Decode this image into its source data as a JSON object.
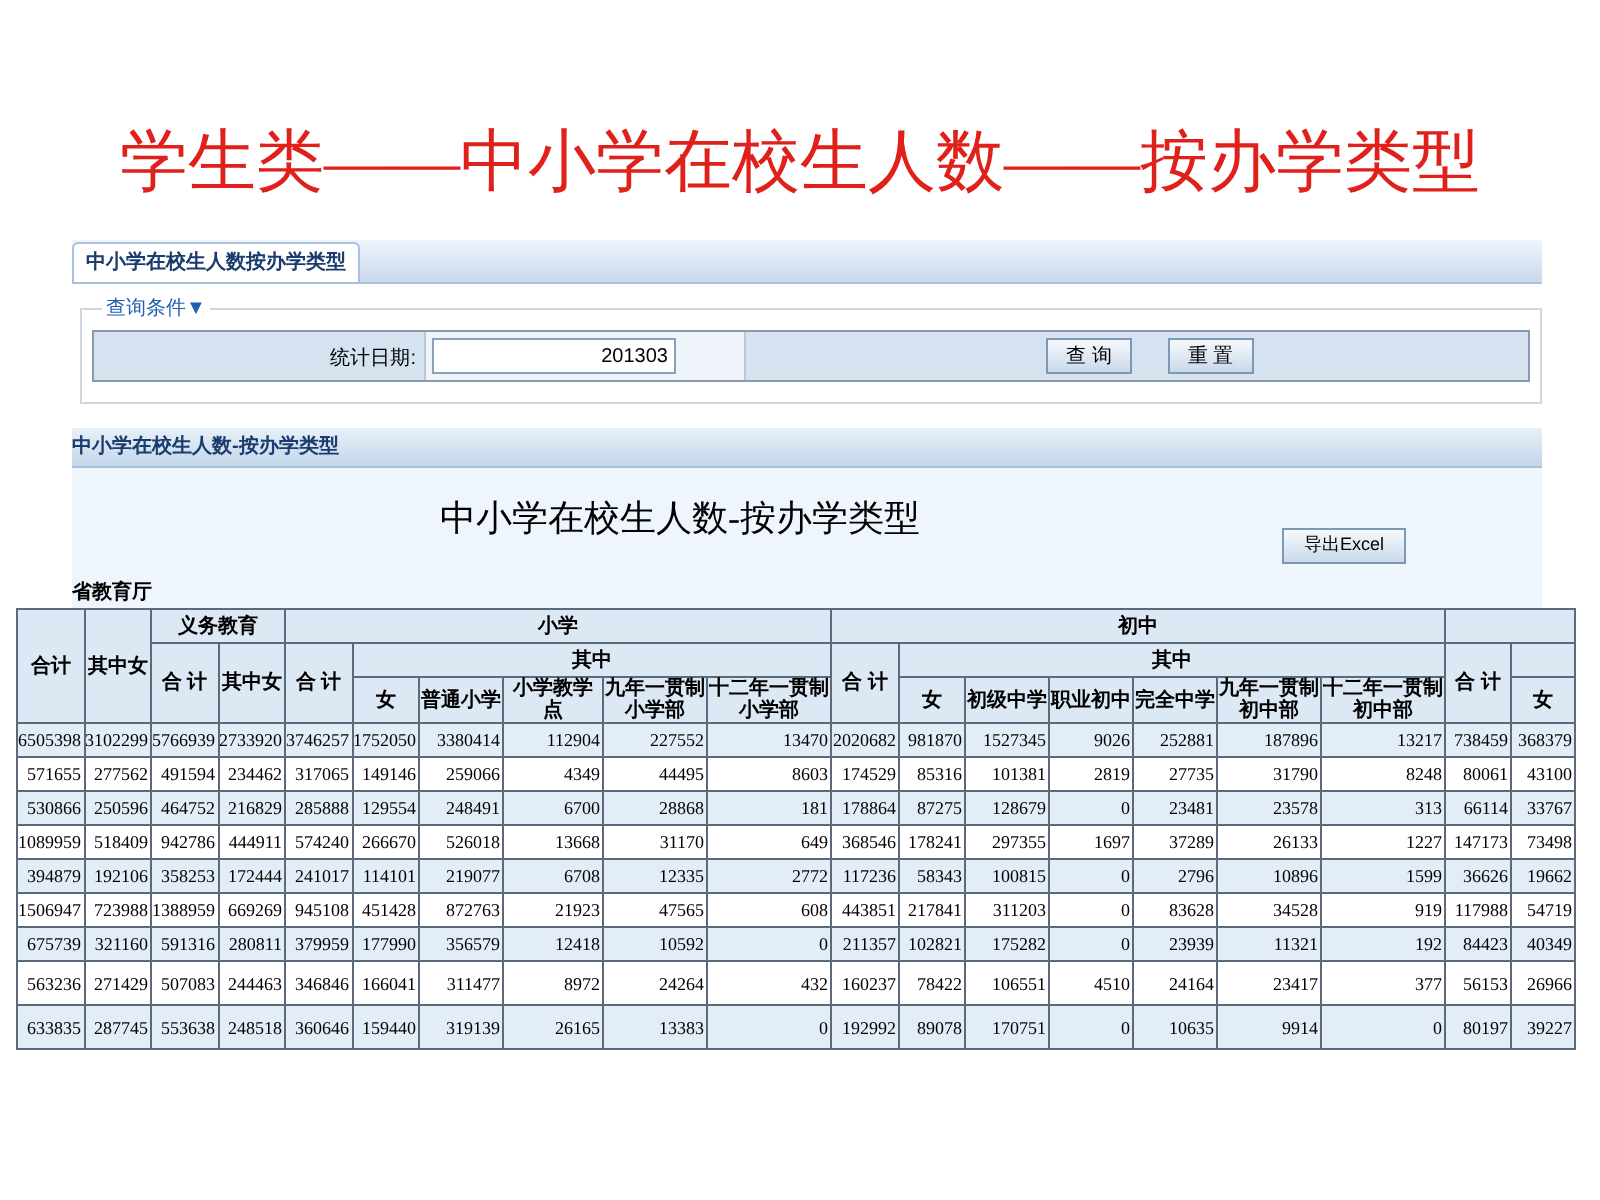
{
  "slide_title": "学生类——中小学在校生人数——按办学类型",
  "tab": {
    "label": "中小学在校生人数按办学类型",
    "selected": true
  },
  "query": {
    "legend": "查询条件▼",
    "date_label": "统计日期:",
    "date_value": "201303",
    "buttons": [
      "查 询",
      "重 置"
    ]
  },
  "section_title": "中小学在校生人数-按办学类型",
  "report_title": "中小学在校生人数-按办学类型",
  "export_button": "导出Excel",
  "unit": "省教育厅",
  "columns": [
    {
      "label": "合计"
    },
    {
      "label": "其中女"
    },
    {
      "label": "义务教育",
      "children": [
        {
          "label": "合 计"
        },
        {
          "label": "其中女"
        }
      ]
    },
    {
      "label": "小学",
      "children": [
        {
          "label": "合 计"
        },
        {
          "label": "其中",
          "children": [
            {
              "label": "女"
            },
            {
              "label": "普通小学"
            },
            {
              "label": "小学教学点"
            },
            {
              "label": "九年一贯制小学部"
            },
            {
              "label": "十二年一贯制小学部"
            }
          ]
        }
      ]
    },
    {
      "label": "初中",
      "children": [
        {
          "label": "合 计"
        },
        {
          "label": "其中",
          "children": [
            {
              "label": "女"
            },
            {
              "label": "初级中学"
            },
            {
              "label": "职业初中"
            },
            {
              "label": "完全中学"
            },
            {
              "label": "九年一贯制初中部"
            },
            {
              "label": "十二年一贯制初中部"
            }
          ]
        }
      ]
    },
    {
      "children": [
        {
          "label": "合 计"
        },
        {
          "children": [
            {
              "label": "女"
            }
          ]
        }
      ]
    }
  ],
  "rows": [
    [
      "6505398",
      "3102299",
      "5766939",
      "2733920",
      "3746257",
      "1752050",
      "3380414",
      "112904",
      "227552",
      "13470",
      "2020682",
      "981870",
      "1527345",
      "9026",
      "252881",
      "187896",
      "13217",
      "738459",
      "368379"
    ],
    [
      "571655",
      "277562",
      "491594",
      "234462",
      "317065",
      "149146",
      "259066",
      "4349",
      "44495",
      "8603",
      "174529",
      "85316",
      "101381",
      "2819",
      "27735",
      "31790",
      "8248",
      "80061",
      "43100"
    ],
    [
      "530866",
      "250596",
      "464752",
      "216829",
      "285888",
      "129554",
      "248491",
      "6700",
      "28868",
      "181",
      "178864",
      "87275",
      "128679",
      "0",
      "23481",
      "23578",
      "313",
      "66114",
      "33767"
    ],
    [
      "1089959",
      "518409",
      "942786",
      "444911",
      "574240",
      "266670",
      "526018",
      "13668",
      "31170",
      "649",
      "368546",
      "178241",
      "297355",
      "1697",
      "37289",
      "26133",
      "1227",
      "147173",
      "73498"
    ],
    [
      "394879",
      "192106",
      "358253",
      "172444",
      "241017",
      "114101",
      "219077",
      "6708",
      "12335",
      "2772",
      "117236",
      "58343",
      "100815",
      "0",
      "2796",
      "10896",
      "1599",
      "36626",
      "19662"
    ],
    [
      "1506947",
      "723988",
      "1388959",
      "669269",
      "945108",
      "451428",
      "872763",
      "21923",
      "47565",
      "608",
      "443851",
      "217841",
      "311203",
      "0",
      "83628",
      "34528",
      "919",
      "117988",
      "54719"
    ],
    [
      "675739",
      "321160",
      "591316",
      "280811",
      "379959",
      "177990",
      "356579",
      "12418",
      "10592",
      "0",
      "211357",
      "102821",
      "175282",
      "0",
      "23939",
      "11321",
      "192",
      "84423",
      "40349"
    ],
    [
      "563236",
      "271429",
      "507083",
      "244463",
      "346846",
      "166041",
      "311477",
      "8972",
      "24264",
      "432",
      "160237",
      "78422",
      "106551",
      "4510",
      "24164",
      "23417",
      "377",
      "56153",
      "26966"
    ],
    [
      "633835",
      "287745",
      "553638",
      "248518",
      "360646",
      "159440",
      "319139",
      "26165",
      "13383",
      "0",
      "192992",
      "89078",
      "170751",
      "0",
      "10635",
      "9914",
      "0",
      "80197",
      "39227"
    ]
  ]
}
